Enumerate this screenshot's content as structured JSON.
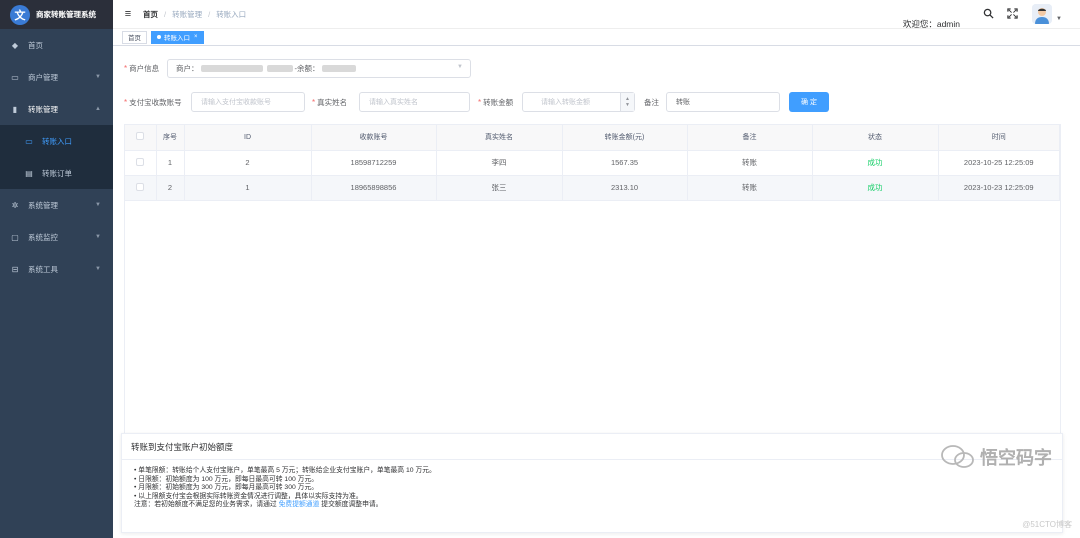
{
  "app": {
    "logo_glyph": "文",
    "title": "商家转账管理系统"
  },
  "sidebar": {
    "items": [
      {
        "label": "首页",
        "icon": "dashboard-icon"
      },
      {
        "label": "商户管理",
        "icon": "shop-icon"
      },
      {
        "label": "转账管理",
        "icon": "book-icon"
      },
      {
        "label": "系统管理",
        "icon": "gear-icon"
      },
      {
        "label": "系统监控",
        "icon": "monitor-icon"
      },
      {
        "label": "系统工具",
        "icon": "toolbox-icon"
      }
    ],
    "sub_items": [
      {
        "label": "转账入口",
        "icon": "entry-icon"
      },
      {
        "label": "转账订单",
        "icon": "order-icon"
      }
    ]
  },
  "header": {
    "breadcrumb": [
      "首页",
      "转账管理",
      "转账入口"
    ],
    "welcome": "欢迎您：admin"
  },
  "tags": {
    "home": "首页",
    "current": "转账入口"
  },
  "form": {
    "merchant_label": "商户信息",
    "merchant_prefix": "商户：",
    "merchant_balance": "-余额：",
    "alipay_label": "支付宝收款账号",
    "alipay_placeholder": "请输入支付宝收款账号",
    "name_label": "真实姓名",
    "name_placeholder": "请输入真实姓名",
    "amount_label": "转账金额",
    "amount_placeholder": "请输入转账金额",
    "remark_label": "备注",
    "remark_value": "转账",
    "confirm_label": "确 定"
  },
  "table": {
    "columns": [
      "序号",
      "ID",
      "收款账号",
      "真实姓名",
      "转账金额(元)",
      "备注",
      "状态",
      "时间"
    ],
    "rows": [
      {
        "index": "1",
        "id": "2",
        "account": "18598712259",
        "name": "李四",
        "amount": "1567.35",
        "remark": "转账",
        "status": "成功",
        "time": "2023-10-25 12:25:09"
      },
      {
        "index": "2",
        "id": "1",
        "account": "18965898856",
        "name": "张三",
        "amount": "2313.10",
        "remark": "转账",
        "status": "成功",
        "time": "2023-10-23 12:25:09"
      }
    ]
  },
  "info": {
    "title": "转账到支付宝账户初始额度",
    "lines": [
      "• 单笔限额：转账给个人支付宝账户，单笔最高 5 万元；转账给企业支付宝账户，单笔最高 10 万元。",
      "• 日限额：初始额度为 100 万元，即每日最高可转 100 万元。",
      "• 月限额：初始额度为 300 万元，即每月最高可转 300 万元。",
      "• 以上限额支付宝会根据实际转账资金情况进行调整，具体以实际支持为准。"
    ],
    "note_prefix": "注意：若初始额度不满足您的业务需求，请通过",
    "note_link": "免费提额通道",
    "note_suffix": "提交额度调整申请。"
  },
  "watermark": {
    "brand": "悟空码字",
    "site": "@51CTO博客"
  },
  "colors": {
    "sidebar": "#304156",
    "primary": "#409eff",
    "success": "#13ce66"
  }
}
